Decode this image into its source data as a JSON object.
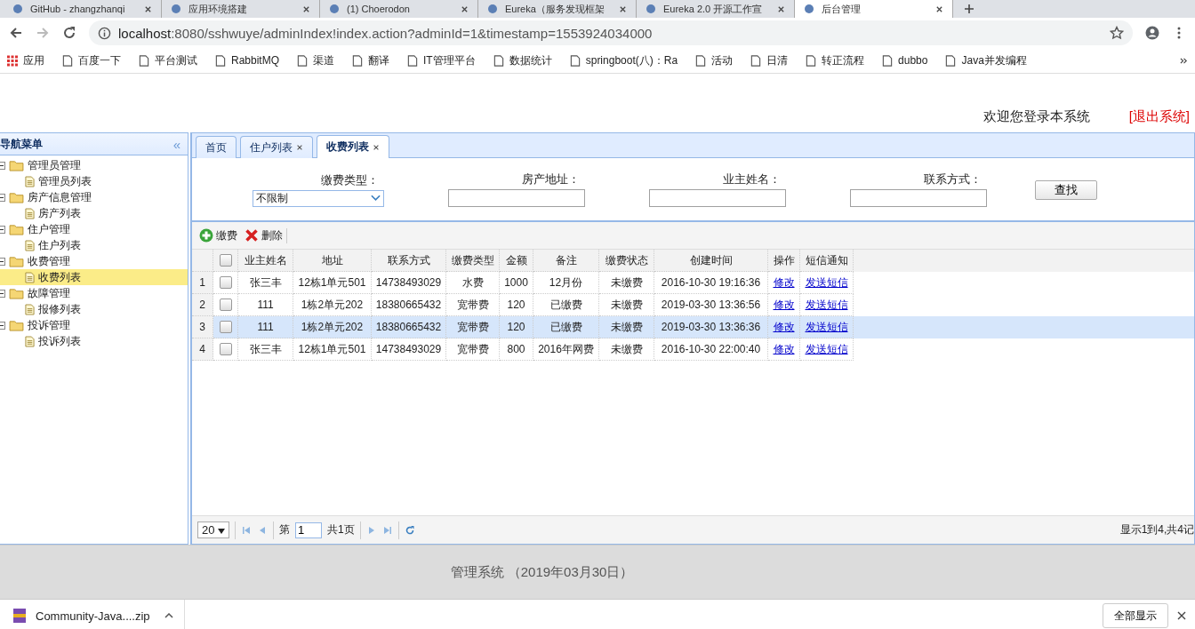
{
  "browser": {
    "tabs": [
      {
        "title": "GitHub - zhangzhanqi",
        "selected": false
      },
      {
        "title": "应用环境搭建",
        "selected": false
      },
      {
        "title": "(1) Choerodon",
        "selected": false
      },
      {
        "title": "Eureka（服务发现框架",
        "selected": false
      },
      {
        "title": "Eureka 2.0 开源工作宣",
        "selected": false
      },
      {
        "title": "后台管理",
        "selected": true
      }
    ],
    "url": {
      "host": "localhost",
      "rest": ":8080/sshwuye/adminIndex!index.action?adminId=1&timestamp=1553924034000"
    },
    "bookmarks": [
      "应用",
      "百度一下",
      "平台测试",
      "RabbitMQ",
      "渠道",
      "翻译",
      "IT管理平台",
      "数据统计",
      "springboot(八)：Ra",
      "活动",
      "日清",
      "转正流程",
      "dubbo",
      "Java并发编程"
    ]
  },
  "header": {
    "welcome": "欢迎您登录本系统",
    "logout": "[退出系统]"
  },
  "nav": {
    "title": "导航菜单",
    "collapse": "«",
    "groups": [
      {
        "label": "管理员管理",
        "expanded": true,
        "children": [
          {
            "label": "管理员列表",
            "selected": false
          }
        ]
      },
      {
        "label": "房产信息管理",
        "expanded": true,
        "children": [
          {
            "label": "房产列表",
            "selected": false
          }
        ]
      },
      {
        "label": "住户管理",
        "expanded": true,
        "children": [
          {
            "label": "住户列表",
            "selected": false
          }
        ]
      },
      {
        "label": "收费管理",
        "expanded": true,
        "children": [
          {
            "label": "收费列表",
            "selected": true
          }
        ]
      },
      {
        "label": "故障管理",
        "expanded": true,
        "children": [
          {
            "label": "报修列表",
            "selected": false
          }
        ]
      },
      {
        "label": "投诉管理",
        "expanded": true,
        "children": [
          {
            "label": "投诉列表",
            "selected": false
          }
        ]
      }
    ]
  },
  "tabs": [
    {
      "label": "首页",
      "closable": false,
      "selected": false
    },
    {
      "label": "住户列表",
      "closable": true,
      "selected": false
    },
    {
      "label": "收费列表",
      "closable": true,
      "selected": true
    }
  ],
  "search": {
    "fields": [
      {
        "label": "缴费类型：",
        "kind": "select",
        "value": "不限制"
      },
      {
        "label": "房产地址：",
        "kind": "text"
      },
      {
        "label": "业主姓名：",
        "kind": "text"
      },
      {
        "label": "联系方式：",
        "kind": "text"
      }
    ],
    "button": "查找"
  },
  "toolbar": [
    {
      "label": "缴费",
      "kind": "add"
    },
    {
      "label": "删除",
      "kind": "delete"
    }
  ],
  "table": {
    "all_checked": false,
    "columns": [
      "业主姓名",
      "地址",
      "联系方式",
      "缴费类型",
      "金额",
      "备注",
      "缴费状态",
      "创建时间",
      "操作",
      "短信通知"
    ],
    "rows": [
      {
        "num": "1",
        "checked": false,
        "highlighted": false,
        "cells": [
          "张三丰",
          "12栋1单元501",
          "14738493029",
          "水费",
          "1000",
          "12月份",
          "未缴费",
          "2016-10-30 19:16:36"
        ],
        "edit": "修改",
        "sms": "发送短信"
      },
      {
        "num": "2",
        "checked": false,
        "highlighted": false,
        "cells": [
          "111",
          "1栋2单元202",
          "18380665432",
          "宽带费",
          "120",
          "已缴费",
          "未缴费",
          "2019-03-30 13:36:56"
        ],
        "edit": "修改",
        "sms": "发送短信"
      },
      {
        "num": "3",
        "checked": false,
        "highlighted": true,
        "cells": [
          "111",
          "1栋2单元202",
          "18380665432",
          "宽带费",
          "120",
          "已缴费",
          "未缴费",
          "2019-03-30 13:36:36"
        ],
        "edit": "修改",
        "sms": "发送短信"
      },
      {
        "num": "4",
        "checked": false,
        "highlighted": false,
        "cells": [
          "张三丰",
          "12栋1单元501",
          "14738493029",
          "宽带费",
          "800",
          "2016年网费",
          "未缴费",
          "2016-10-30 22:00:40"
        ],
        "edit": "修改",
        "sms": "发送短信"
      }
    ]
  },
  "pager": {
    "page_size": "20",
    "page_prefix": "第",
    "page": "1",
    "page_total": "共1页",
    "info": "显示1到4,共4记"
  },
  "footer": "管理系统 （2019年03月30日）",
  "downloads": {
    "file": "Community-Java....zip",
    "show_all": "全部显示"
  }
}
